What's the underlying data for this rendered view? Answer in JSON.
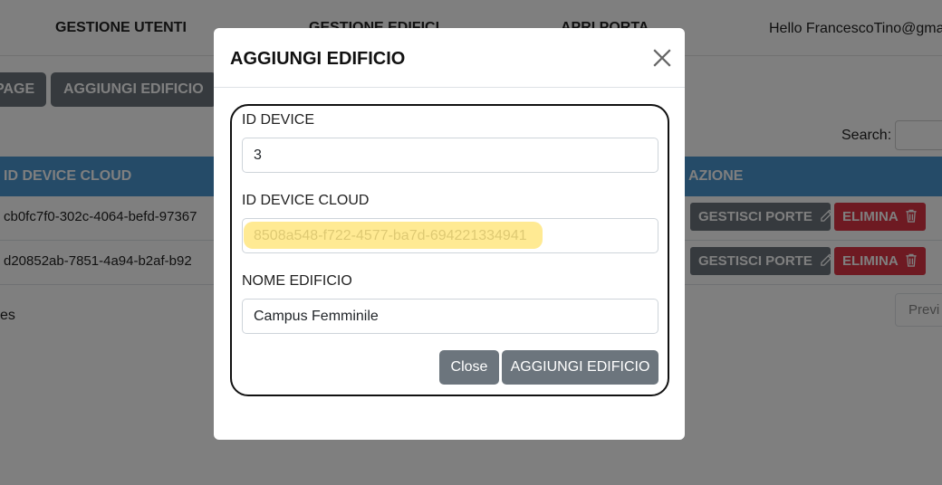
{
  "navbar": {
    "links": [
      "GESTIONE UTENTI",
      "GESTIONE EDIFICI",
      "APRI PORTA"
    ],
    "greeting": "Hello FrancescoTino@gma"
  },
  "toolbar": {
    "home_label": "PAGE",
    "add_label": "AGGIUNGI EDIFICIO"
  },
  "search": {
    "label": "Search:",
    "value": ""
  },
  "table": {
    "headers": {
      "cloud": "ID DEVICE CLOUD",
      "action": "AZIONE"
    },
    "rows": [
      {
        "cloud": "cb0fc7f0-302c-4064-befd-97367"
      },
      {
        "cloud": "d20852ab-7851-4a94-b2af-b92"
      }
    ],
    "actions": {
      "manage": "GESTISCI PORTE",
      "delete": "ELIMINA"
    }
  },
  "footer": {
    "entries": "es",
    "prev": "Previ"
  },
  "modal": {
    "title": "AGGIUNGI EDIFICIO",
    "fields": {
      "device": {
        "label": "ID DEVICE",
        "value": "3"
      },
      "cloud": {
        "label": "ID DEVICE CLOUD",
        "value": "8508a548-f722-4577-ba7d-694221334941"
      },
      "name": {
        "label": "NOME EDIFICIO",
        "value": "Campus Femminile"
      }
    },
    "close_label": "Close",
    "submit_label": "AGGIUNGI EDIFICIO"
  },
  "colors": {
    "header_blue": "#4b97d1",
    "secondary": "#6c757d",
    "danger": "#dc3545",
    "highlight": "#ffe680"
  }
}
